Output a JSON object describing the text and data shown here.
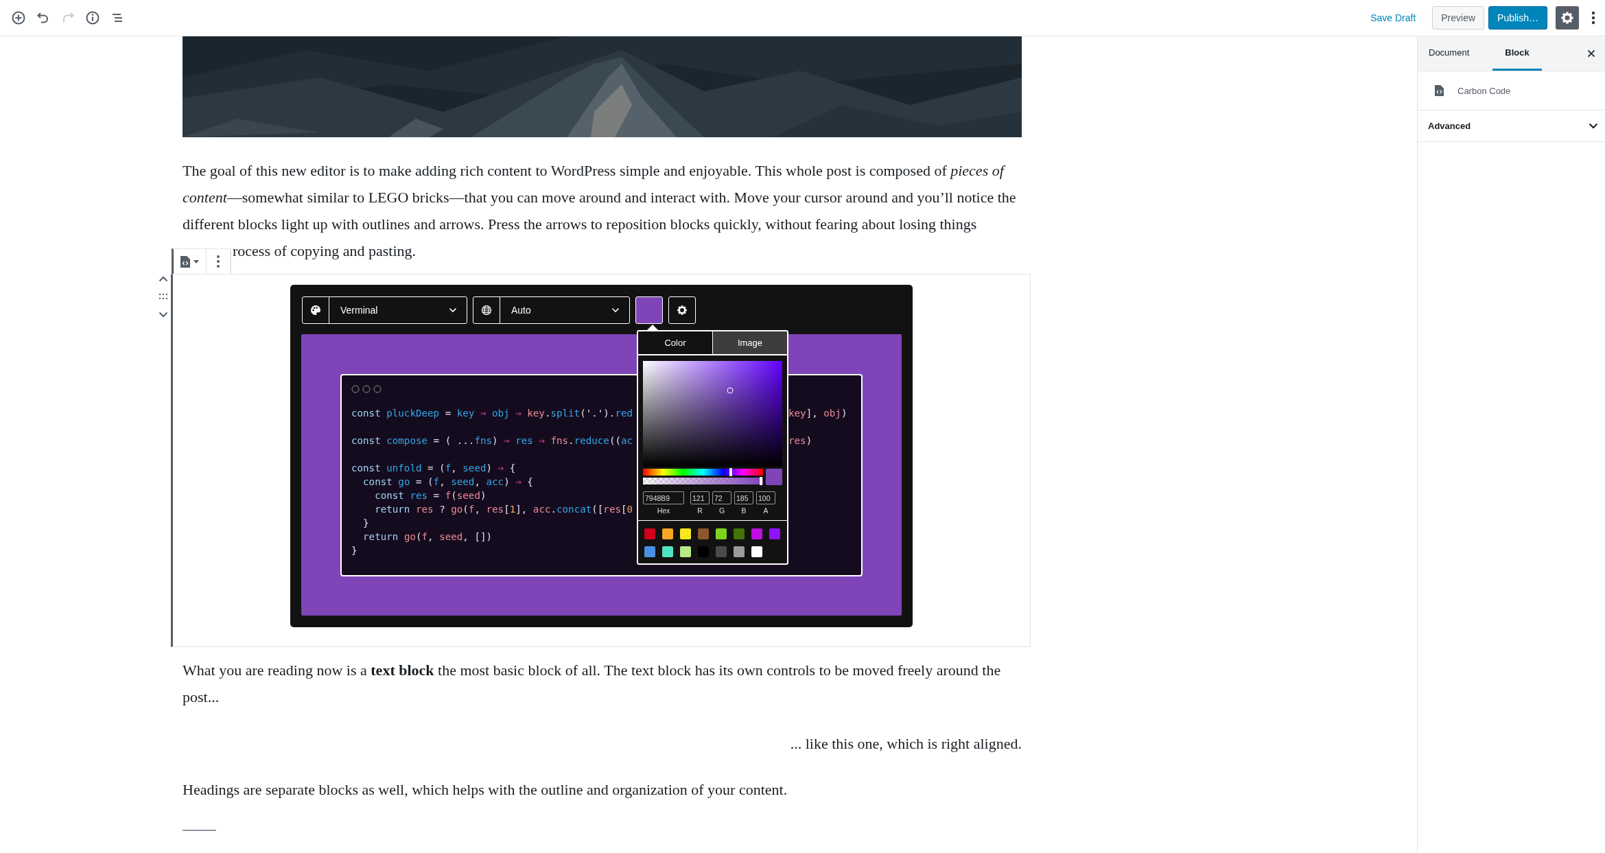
{
  "toolbar": {
    "icons": [
      {
        "kind": "add",
        "disabled": false
      },
      {
        "kind": "undo",
        "disabled": false
      },
      {
        "kind": "redo",
        "disabled": true
      },
      {
        "kind": "info",
        "disabled": false
      },
      {
        "kind": "outline",
        "disabled": false
      }
    ],
    "save_draft": "Save Draft",
    "preview": "Preview",
    "publish": "Publish…",
    "settings_active": true
  },
  "content": {
    "intro": "The goal of this new editor is to make adding rich content to WordPress simple and enjoyable. This whole post is composed of *pieces of content*—somewhat similar to LEGO bricks—that you can move around and interact with. Move your cursor around and you’ll notice the different blocks light up with outlines and arrows. Press the arrows to reposition blocks quickly, without fearing about losing things",
    "intro_fragment": "rocess of copying and pasting.",
    "carbon": {
      "theme": "Verminal",
      "language": "Auto",
      "color": "#7f45b8",
      "code": [
        {
          "left": [
            {
              "text": "const ",
              "kind": "kw"
            },
            {
              "text": "pluckDeep",
              "kind": "def"
            },
            {
              "text": " = ",
              "kind": "punct"
            },
            {
              "text": "key",
              "kind": "def"
            },
            {
              "text": " ⇒ ",
              "kind": "op"
            },
            {
              "text": "obj",
              "kind": "def"
            },
            {
              "text": " ⇒ ",
              "kind": "op"
            },
            {
              "text": "key",
              "kind": "use"
            },
            {
              "text": ".",
              "kind": "punct"
            },
            {
              "text": "split",
              "kind": "def"
            },
            {
              "text": "('.').",
              "kind": "punct"
            },
            {
              "text": "red",
              "kind": "def"
            }
          ],
          "right": [
            {
              "text": "key",
              "kind": "use"
            },
            {
              "text": "], ",
              "kind": "punct"
            },
            {
              "text": "obj",
              "kind": "use"
            },
            {
              "text": ")",
              "kind": "punct"
            }
          ]
        },
        {
          "space_before": true,
          "left": [
            {
              "text": "const ",
              "kind": "kw"
            },
            {
              "text": "compose",
              "kind": "def"
            },
            {
              "text": " = ( ...",
              "kind": "punct"
            },
            {
              "text": "fns",
              "kind": "def"
            },
            {
              "text": ") ",
              "kind": "punct"
            },
            {
              "text": "⇒ ",
              "kind": "op"
            },
            {
              "text": "res",
              "kind": "def"
            },
            {
              "text": " ⇒ ",
              "kind": "op"
            },
            {
              "text": "fns",
              "kind": "use"
            },
            {
              "text": ".",
              "kind": "punct"
            },
            {
              "text": "reduce",
              "kind": "def"
            },
            {
              "text": "((",
              "kind": "punct"
            },
            {
              "text": "ac",
              "kind": "def"
            }
          ],
          "right": [
            {
              "text": "res",
              "kind": "use"
            },
            {
              "text": ")",
              "kind": "punct"
            }
          ]
        },
        {
          "space_before": true,
          "left": [
            {
              "text": "const ",
              "kind": "kw"
            },
            {
              "text": "unfold",
              "kind": "def"
            },
            {
              "text": " = (",
              "kind": "punct"
            },
            {
              "text": "f",
              "kind": "def"
            },
            {
              "text": ", ",
              "kind": "punct"
            },
            {
              "text": "seed",
              "kind": "def"
            },
            {
              "text": ") ",
              "kind": "punct"
            },
            {
              "text": "⇒",
              "kind": "op"
            },
            {
              "text": " {",
              "kind": "punct"
            }
          ]
        },
        {
          "left": [
            {
              "text": "  const ",
              "kind": "kw"
            },
            {
              "text": "go",
              "kind": "def"
            },
            {
              "text": " = (",
              "kind": "punct"
            },
            {
              "text": "f",
              "kind": "def"
            },
            {
              "text": ", ",
              "kind": "punct"
            },
            {
              "text": "seed",
              "kind": "def"
            },
            {
              "text": ", ",
              "kind": "punct"
            },
            {
              "text": "acc",
              "kind": "def"
            },
            {
              "text": ") ",
              "kind": "punct"
            },
            {
              "text": "⇒",
              "kind": "op"
            },
            {
              "text": " {",
              "kind": "punct"
            }
          ]
        },
        {
          "left": [
            {
              "text": "    const ",
              "kind": "kw"
            },
            {
              "text": "res",
              "kind": "def"
            },
            {
              "text": " = ",
              "kind": "punct"
            },
            {
              "text": "f",
              "kind": "use"
            },
            {
              "text": "(",
              "kind": "punct"
            },
            {
              "text": "seed",
              "kind": "use"
            },
            {
              "text": ")",
              "kind": "punct"
            }
          ]
        },
        {
          "left": [
            {
              "text": "    return ",
              "kind": "kw"
            },
            {
              "text": "res",
              "kind": "use"
            },
            {
              "text": " ? ",
              "kind": "punct"
            },
            {
              "text": "go",
              "kind": "use"
            },
            {
              "text": "(",
              "kind": "punct"
            },
            {
              "text": "f",
              "kind": "use"
            },
            {
              "text": ", ",
              "kind": "punct"
            },
            {
              "text": "res",
              "kind": "use"
            },
            {
              "text": "[",
              "kind": "punct"
            },
            {
              "text": "1",
              "kind": "num"
            },
            {
              "text": "], ",
              "kind": "punct"
            },
            {
              "text": "acc",
              "kind": "use"
            },
            {
              "text": ".",
              "kind": "punct"
            },
            {
              "text": "concat",
              "kind": "def"
            },
            {
              "text": "([",
              "kind": "punct"
            },
            {
              "text": "res",
              "kind": "use"
            },
            {
              "text": "[",
              "kind": "punct"
            },
            {
              "text": "0",
              "kind": "num"
            }
          ]
        },
        {
          "left": [
            {
              "text": "  }",
              "kind": "punct"
            }
          ]
        },
        {
          "left": [
            {
              "text": "  return ",
              "kind": "kw"
            },
            {
              "text": "go",
              "kind": "use"
            },
            {
              "text": "(",
              "kind": "punct"
            },
            {
              "text": "f",
              "kind": "use"
            },
            {
              "text": ", ",
              "kind": "punct"
            },
            {
              "text": "seed",
              "kind": "use"
            },
            {
              "text": ", [])",
              "kind": "punct"
            }
          ]
        },
        {
          "left": [
            {
              "text": "}",
              "kind": "punct"
            }
          ]
        }
      ],
      "picker": {
        "tabs": [
          {
            "label": "Color",
            "selected": true
          },
          {
            "label": "Image",
            "selected": false
          }
        ],
        "hue": {
          "level": 0.73
        },
        "alpha": {
          "level": 0.98
        },
        "fields": [
          {
            "value": "7948B9",
            "label": "Hex"
          },
          {
            "value": "121",
            "label": "R"
          },
          {
            "value": "72",
            "label": "G"
          },
          {
            "value": "185",
            "label": "B"
          },
          {
            "value": "100",
            "label": "A"
          }
        ],
        "swatches": [
          {
            "color": "#d0021b"
          },
          {
            "color": "#f5a623"
          },
          {
            "color": "#f8e71c"
          },
          {
            "color": "#8b572a"
          },
          {
            "color": "#7ed321"
          },
          {
            "color": "#417505"
          },
          {
            "color": "#bd10e0"
          },
          {
            "color": "#9013fe"
          },
          {
            "color": "#4a90e2"
          },
          {
            "color": "#50e3c2"
          },
          {
            "color": "#b8e986"
          },
          {
            "color": "#000000"
          },
          {
            "color": "#4a4a4a"
          },
          {
            "color": "#9b9b9b"
          },
          {
            "color": "#ffffff"
          }
        ]
      }
    },
    "after": "What you are reading now is a **text block** the most basic block of all. The text block has its own controls to be moved freely around the post...",
    "right_aligned": "... like this one, which is right aligned.",
    "headings": "Headings are separate blocks as well, which helps with the outline and organization of your content."
  },
  "sidebar": {
    "tabs": [
      {
        "label": "Document",
        "selected": false
      },
      {
        "label": "Block",
        "selected": true
      }
    ],
    "block_name": "Carbon Code",
    "panels": [
      {
        "title": "Advanced",
        "expanded": false
      }
    ]
  }
}
